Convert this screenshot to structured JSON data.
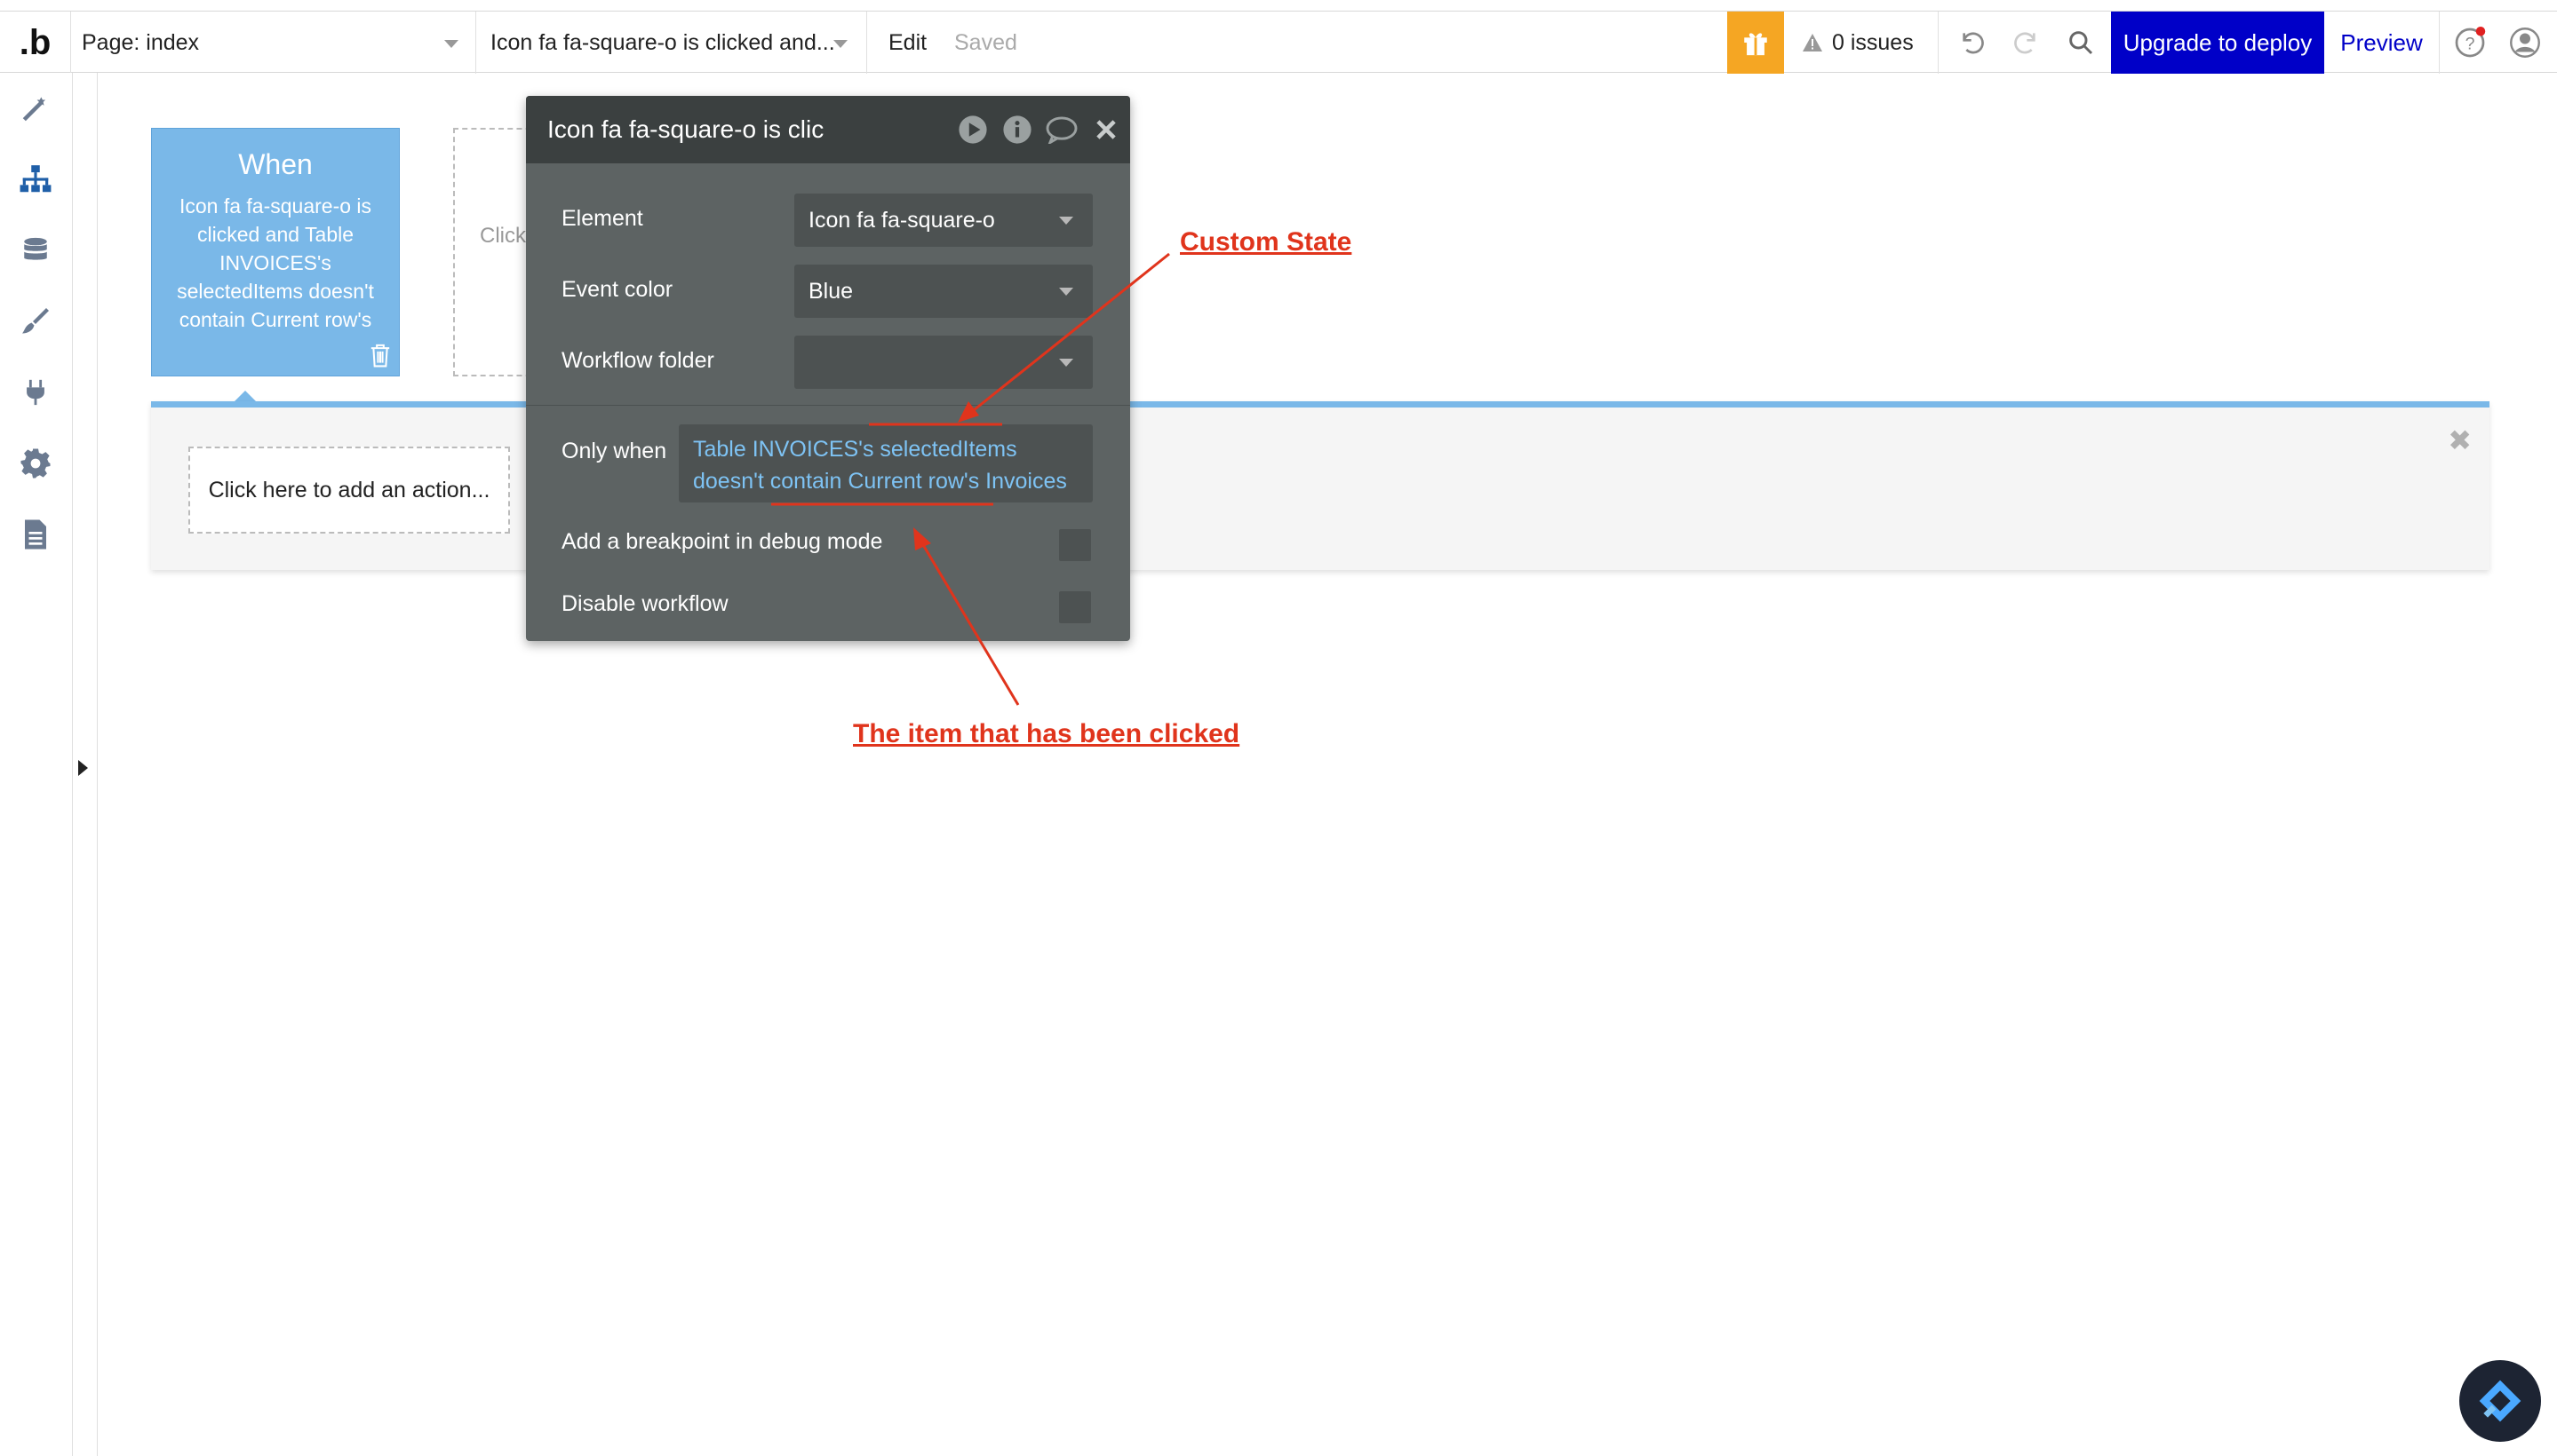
{
  "topbar": {
    "logo": "b",
    "page_selector": "Page: index",
    "workflow_selector": "Icon fa fa-square-o is clicked and...",
    "edit_label": "Edit",
    "saved_label": "Saved",
    "issues_label": "0 issues",
    "deploy_label": "Upgrade to deploy",
    "preview_label": "Preview",
    "accent_color": "#0000c8",
    "gift_color": "#f5a623"
  },
  "sidebar": {
    "items": [
      {
        "icon": "design-icon"
      },
      {
        "icon": "workflow-icon"
      },
      {
        "icon": "data-icon"
      },
      {
        "icon": "styles-icon"
      },
      {
        "icon": "plugins-icon"
      },
      {
        "icon": "settings-icon"
      },
      {
        "icon": "logs-icon"
      }
    ]
  },
  "canvas": {
    "when_title": "When",
    "when_text": "Icon fa fa-square-o is clicked and Table INVOICES's selectedItems doesn't contain Current row's",
    "ghost_text": "Click",
    "add_action": "Click here to add an action...",
    "event_color": "#7ab8e8"
  },
  "editor": {
    "title": "Icon fa fa-square-o is clic",
    "element_label": "Element",
    "element_value": "Icon fa fa-square-o",
    "color_label": "Event color",
    "color_value": "Blue",
    "folder_label": "Workflow folder",
    "folder_value": "",
    "only_when_label": "Only when",
    "only_when_value": "Table INVOICES's selectedItems doesn't contain Current row's Invoices",
    "breakpoint_label": "Add a breakpoint in debug mode",
    "disable_label": "Disable workflow"
  },
  "annotations": {
    "custom_state": "Custom State",
    "clicked_item": "The item that has been clicked",
    "color": "#e0341c"
  }
}
